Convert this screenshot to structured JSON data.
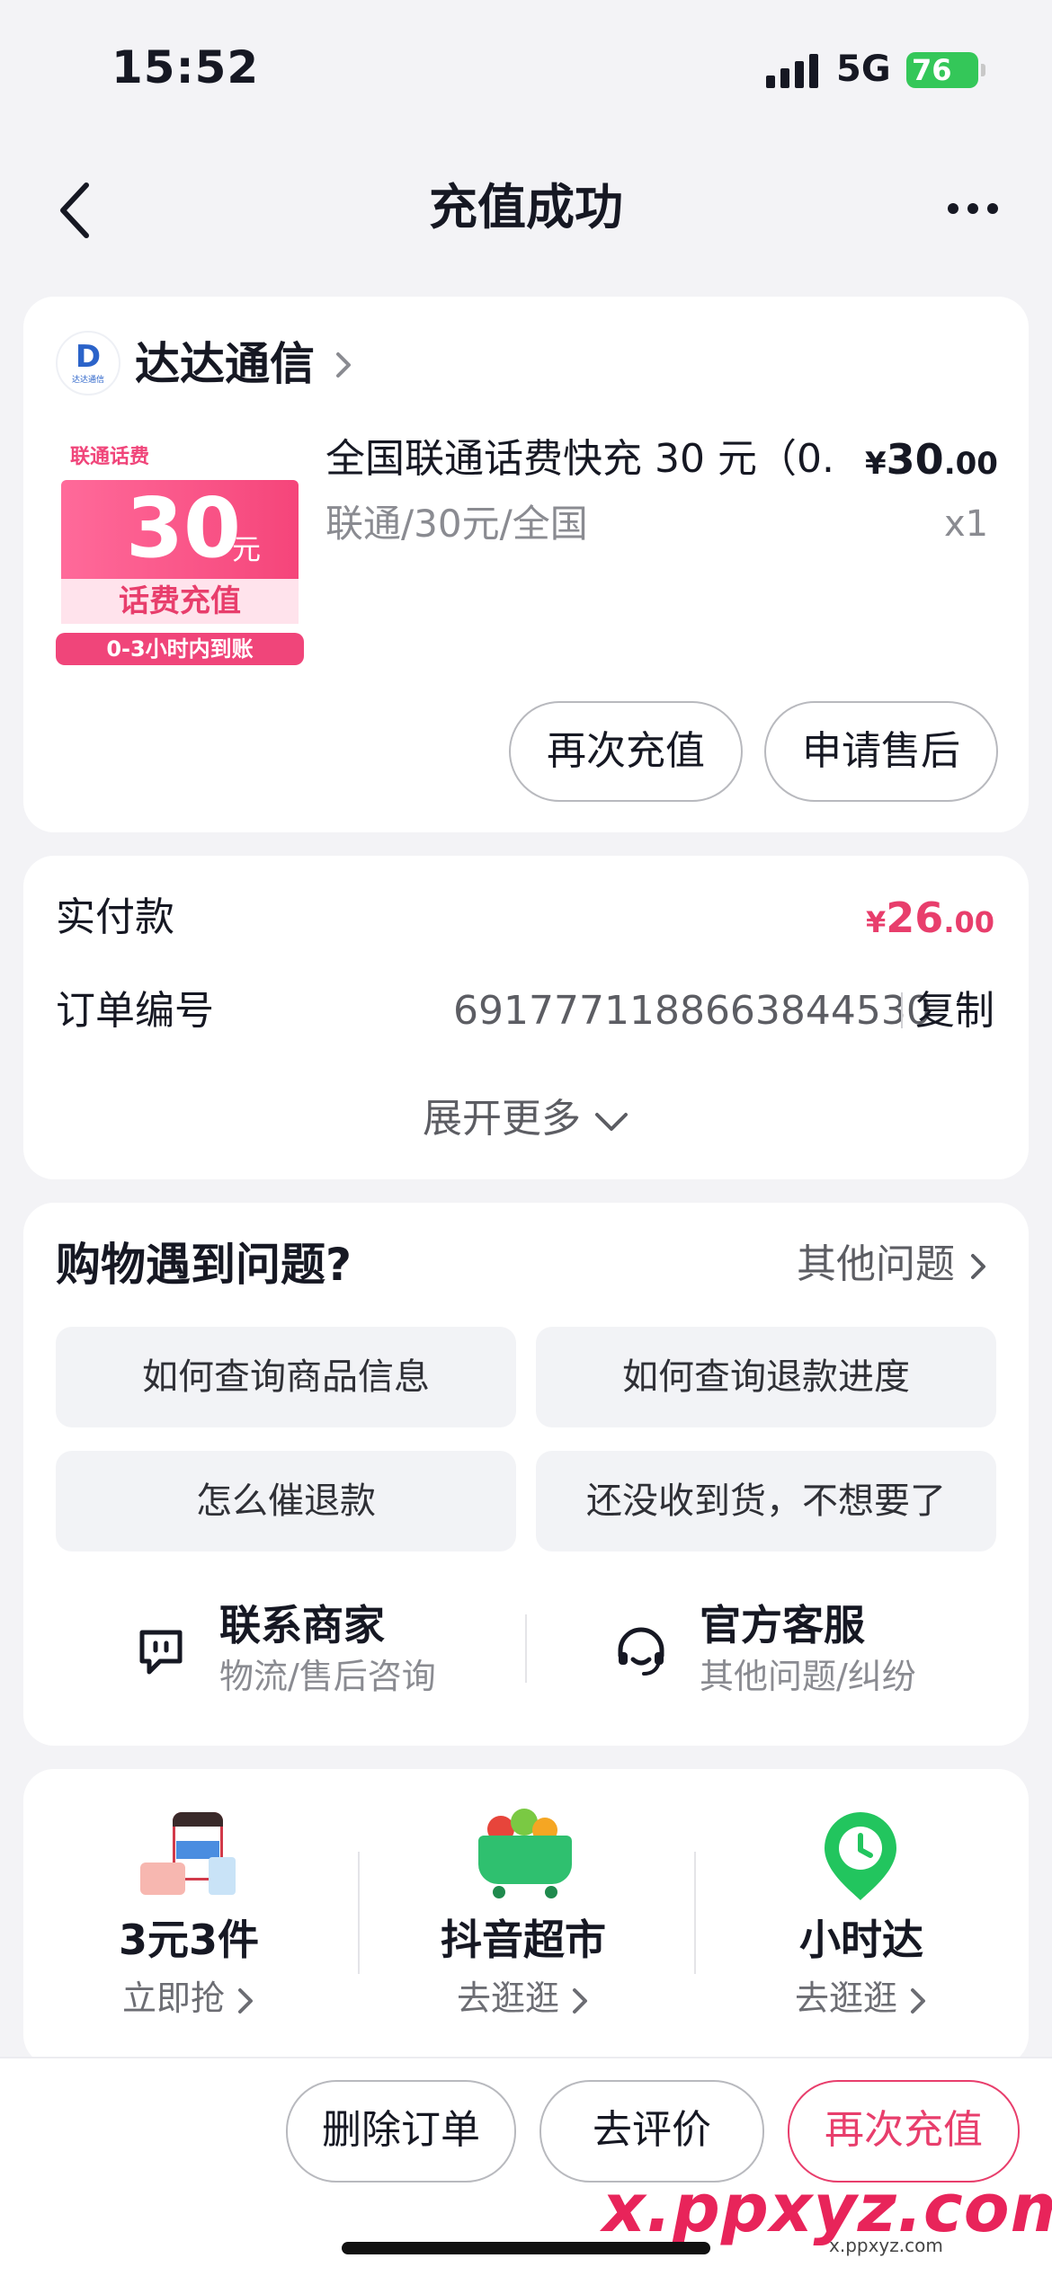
{
  "status_bar": {
    "time": "15:52",
    "network": "5G",
    "battery": "76"
  },
  "nav": {
    "title": "充值成功"
  },
  "shop": {
    "logo_letter": "D",
    "logo_text": "达达通信",
    "name": "达达通信"
  },
  "product": {
    "image": {
      "tag": "联通话费",
      "amount": "30",
      "unit": "元",
      "label": "话费充值",
      "note": "0-3小时内到账"
    },
    "title": "全国联通话费快充 30 元（0...",
    "price_symbol": "¥",
    "price_int": "30",
    "price_dec": ".00",
    "spec": "联通/30元/全国",
    "qty": "x1"
  },
  "actions": {
    "recharge_again": "再次充值",
    "after_sale": "申请售后"
  },
  "payment": {
    "paid_label": "实付款",
    "paid_symbol": "¥",
    "paid_int": "26",
    "paid_dec": ".00",
    "order_label": "订单编号",
    "order_no": "6917771188663844530",
    "copy": "复制",
    "expand": "展开更多"
  },
  "help": {
    "title": "购物遇到问题?",
    "other": "其他问题",
    "questions": [
      "如何查询商品信息",
      "如何查询退款进度",
      "怎么催退款",
      "还没收到货，不想要了"
    ],
    "merchant": {
      "title": "联系商家",
      "sub": "物流/售后咨询"
    },
    "service": {
      "title": "官方客服",
      "sub": "其他问题/纠纷"
    }
  },
  "promos": [
    {
      "title": "3元3件",
      "sub": "立即抢"
    },
    {
      "title": "抖音超市",
      "sub": "去逛逛"
    },
    {
      "title": "小时达",
      "sub": "去逛逛"
    }
  ],
  "bottom": {
    "delete": "删除订单",
    "review": "去评价",
    "recharge": "再次充值"
  },
  "watermark": {
    "text": "x.ppxyz.com",
    "small": "x.ppxyz.com"
  },
  "colors": {
    "accent": "#e83e6c",
    "bg": "#f3f3f6",
    "card": "#ffffff",
    "battery": "#34c759"
  }
}
